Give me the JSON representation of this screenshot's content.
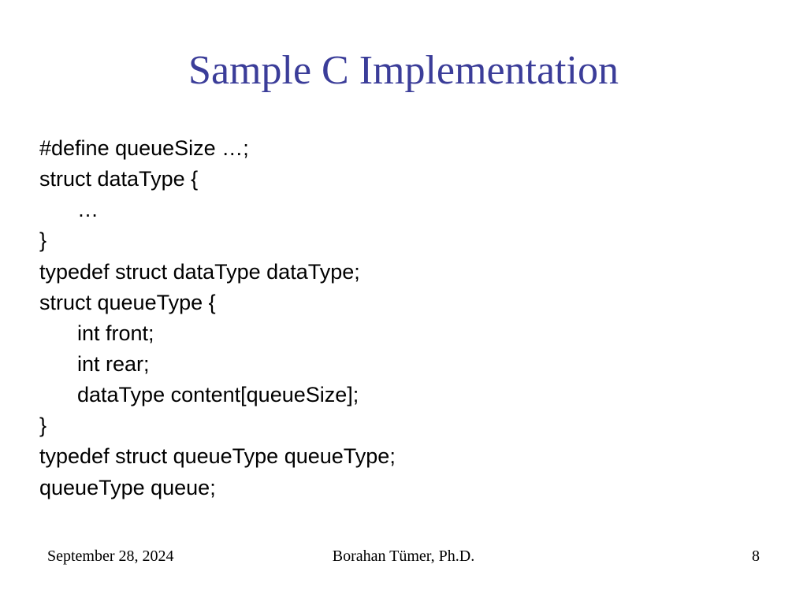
{
  "title": "Sample C Implementation",
  "code": {
    "line1": "#define queueSize …;",
    "line2": "struct dataType {",
    "line3": "…",
    "line4": "}",
    "line5": "typedef struct dataType dataType;",
    "line6": "struct queueType {",
    "line7": "int front;",
    "line8": "int rear;",
    "line9": "dataType content[queueSize];",
    "line10": "}",
    "line11": "typedef struct queueType queueType;",
    "line12": "queueType queue;"
  },
  "footer": {
    "date": "September 28, 2024",
    "author": "Borahan Tümer, Ph.D.",
    "page": "8"
  }
}
